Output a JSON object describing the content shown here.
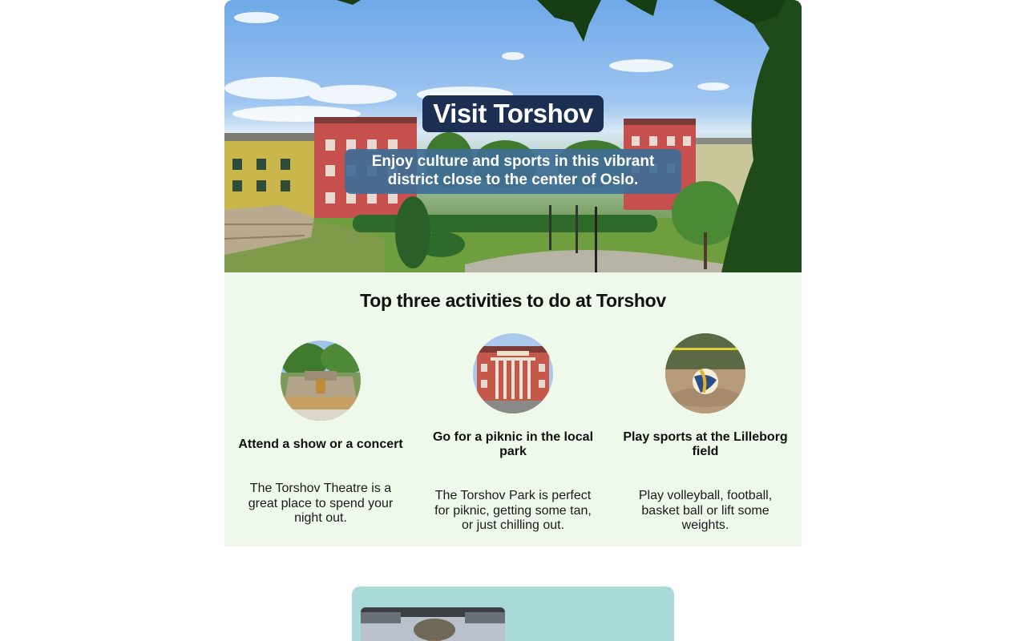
{
  "hero": {
    "title": "Visit Torshov",
    "subtitle": "Enjoy culture and sports in this vibrant district close to the center of Oslo.",
    "colors": {
      "title_bg": "#1c2f52",
      "subtitle_bg": "#3f6e96"
    }
  },
  "activities": {
    "heading": "Top three activities to do at Torshov",
    "background": "#eef9ec",
    "items": [
      {
        "icon": "fountain-image",
        "title": "Attend a show or a concert",
        "description": "The Torshov Theatre is a great place to spend your night out."
      },
      {
        "icon": "theatre-building-image",
        "title": "Go for a piknic in the local park",
        "description": "The Torshov Park is perfect for piknic, getting some tan, or just chilling out."
      },
      {
        "icon": "volleyball-image",
        "title": "Play sports at the Lilleborg field",
        "description": "Play volleyball, football, basket ball or lift some weights."
      }
    ]
  },
  "testimonial": {
    "background": "#a8dad8",
    "photo_icon": "person-photo"
  }
}
